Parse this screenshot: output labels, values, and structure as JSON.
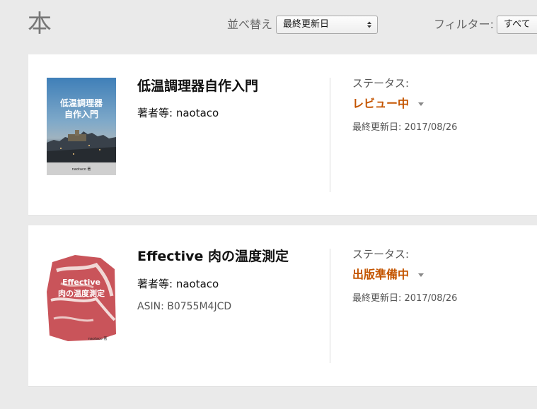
{
  "page_title": "本",
  "sort": {
    "label": "並べ替え",
    "selected": "最終更新日"
  },
  "filter": {
    "label": "フィルター:",
    "selected": "すべて"
  },
  "books": [
    {
      "cover_lines": [
        "低温調理器",
        "自作入門"
      ],
      "cover_author": "naotaco 著",
      "title": "低温調理器自作入門",
      "author_label": "著者等:",
      "author": "naotaco",
      "status_label": "ステータス:",
      "status": "レビュー中",
      "updated": "最終更新日: 2017/08/26"
    },
    {
      "cover_lines": [
        "Effective",
        "肉の温度測定"
      ],
      "cover_author": "naotaco 著",
      "title": "Effective 肉の温度測定",
      "author_label": "著者等:",
      "author": "naotaco",
      "asin": "ASIN: B0755M4JCD",
      "status_label": "ステータス:",
      "status": "出版準備中",
      "updated": "最終更新日: 2017/08/26"
    }
  ],
  "colors": {
    "background": "#eaeaea",
    "card": "#ffffff",
    "status_accent": "#c45500",
    "muted_text": "#555555"
  }
}
